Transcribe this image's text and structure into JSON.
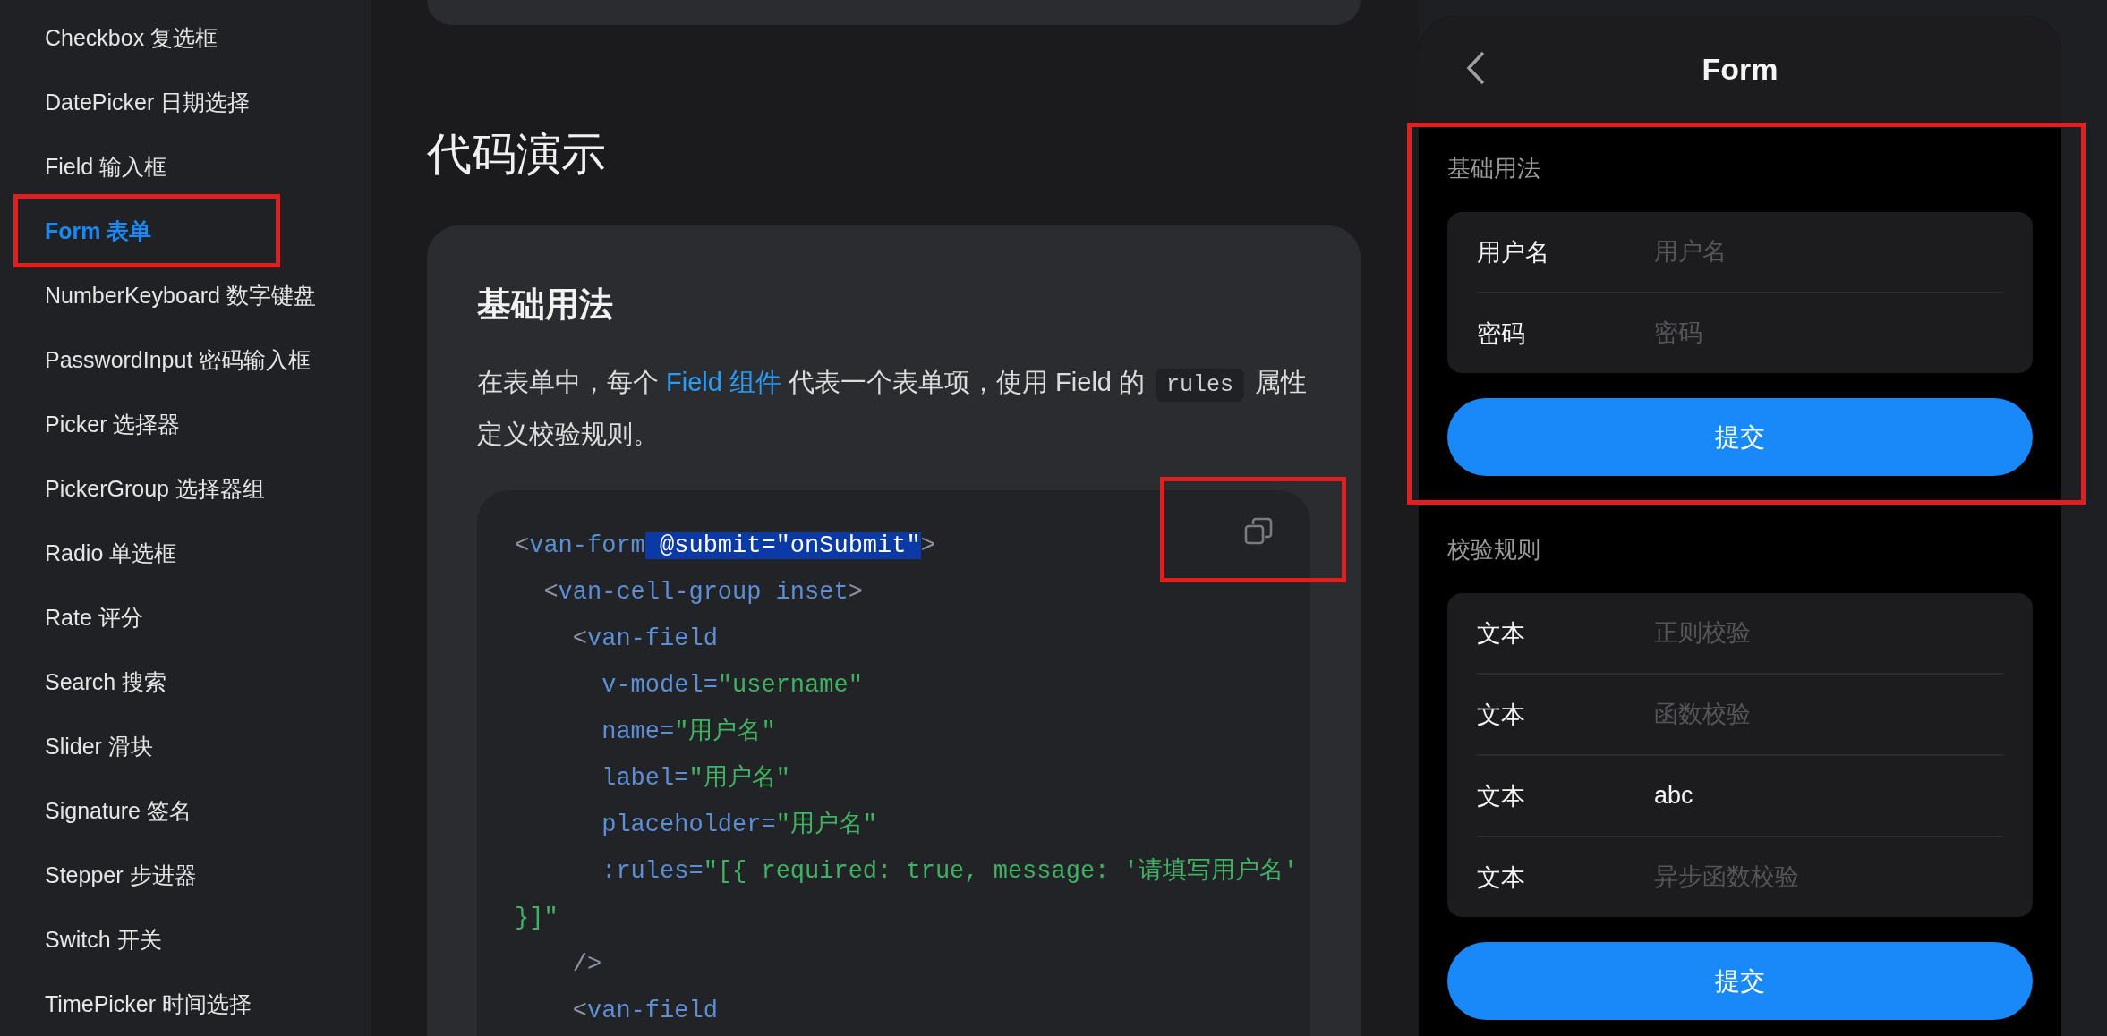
{
  "sidebar": {
    "items": [
      {
        "label": "Checkbox 复选框",
        "selected": false,
        "highlighted": false
      },
      {
        "label": "DatePicker 日期选择",
        "selected": false,
        "highlighted": false
      },
      {
        "label": "Field 输入框",
        "selected": false,
        "highlighted": false
      },
      {
        "label": "Form 表单",
        "selected": true,
        "highlighted": true
      },
      {
        "label": "NumberKeyboard 数字键盘",
        "selected": false,
        "highlighted": false
      },
      {
        "label": "PasswordInput 密码输入框",
        "selected": false,
        "highlighted": false
      },
      {
        "label": "Picker 选择器",
        "selected": false,
        "highlighted": false
      },
      {
        "label": "PickerGroup 选择器组",
        "selected": false,
        "highlighted": false
      },
      {
        "label": "Radio 单选框",
        "selected": false,
        "highlighted": false
      },
      {
        "label": "Rate 评分",
        "selected": false,
        "highlighted": false
      },
      {
        "label": "Search 搜索",
        "selected": false,
        "highlighted": false
      },
      {
        "label": "Slider 滑块",
        "selected": false,
        "highlighted": false
      },
      {
        "label": "Signature 签名",
        "selected": false,
        "highlighted": false
      },
      {
        "label": "Stepper 步进器",
        "selected": false,
        "highlighted": false
      },
      {
        "label": "Switch 开关",
        "selected": false,
        "highlighted": false
      },
      {
        "label": "TimePicker 时间选择",
        "selected": false,
        "highlighted": false
      }
    ]
  },
  "main": {
    "heading": "代码演示",
    "demo": {
      "title": "基础用法",
      "description": [
        {
          "kind": "text",
          "text": "在表单中，每个 "
        },
        {
          "kind": "link",
          "text": "Field 组件"
        },
        {
          "kind": "text",
          "text": " 代表一个表单项，使用 Field 的 "
        },
        {
          "kind": "code",
          "text": "rules"
        },
        {
          "kind": "text",
          "text": " 属性定义校验规则。"
        }
      ],
      "code": {
        "copy_highlighted": true,
        "lines": [
          [
            {
              "kind": "punct",
              "text": "<"
            },
            {
              "kind": "tag",
              "text": "van-form"
            },
            {
              "kind": "selection",
              "text": " @submit=\"onSubmit\""
            },
            {
              "kind": "punct",
              "text": ">"
            }
          ],
          [
            {
              "kind": "punct",
              "text": "  <"
            },
            {
              "kind": "tag",
              "text": "van-cell-group inset"
            },
            {
              "kind": "punct",
              "text": ">"
            }
          ],
          [
            {
              "kind": "punct",
              "text": "    <"
            },
            {
              "kind": "tag",
              "text": "van-field"
            }
          ],
          [
            {
              "kind": "tag",
              "text": "      v-model="
            },
            {
              "kind": "string",
              "text": "\"username\""
            }
          ],
          [
            {
              "kind": "tag",
              "text": "      name="
            },
            {
              "kind": "string",
              "text": "\"用户名\""
            }
          ],
          [
            {
              "kind": "tag",
              "text": "      label="
            },
            {
              "kind": "string",
              "text": "\"用户名\""
            }
          ],
          [
            {
              "kind": "tag",
              "text": "      placeholder="
            },
            {
              "kind": "string",
              "text": "\"用户名\""
            }
          ],
          [
            {
              "kind": "tag",
              "text": "      :rules="
            },
            {
              "kind": "string",
              "text": "\"[{ required: true, message: '请填写用户名'"
            }
          ],
          [
            {
              "kind": "string",
              "text": "}]\""
            }
          ],
          [
            {
              "kind": "punct",
              "text": "    />"
            }
          ],
          [
            {
              "kind": "punct",
              "text": "    <"
            },
            {
              "kind": "tag",
              "text": "van-field"
            }
          ]
        ]
      }
    }
  },
  "preview": {
    "title": "Form",
    "sections": [
      {
        "title": "基础用法",
        "highlighted": true,
        "fields": [
          {
            "label": "用户名",
            "placeholder": "用户名"
          },
          {
            "label": "密码",
            "placeholder": "密码"
          }
        ],
        "submit": "提交"
      },
      {
        "title": "校验规则",
        "highlighted": false,
        "fields": [
          {
            "label": "文本",
            "placeholder": "正则校验"
          },
          {
            "label": "文本",
            "placeholder": "函数校验"
          },
          {
            "label": "文本",
            "value": "abc"
          },
          {
            "label": "文本",
            "placeholder": "异步函数校验"
          }
        ],
        "submit": "提交"
      }
    ]
  }
}
